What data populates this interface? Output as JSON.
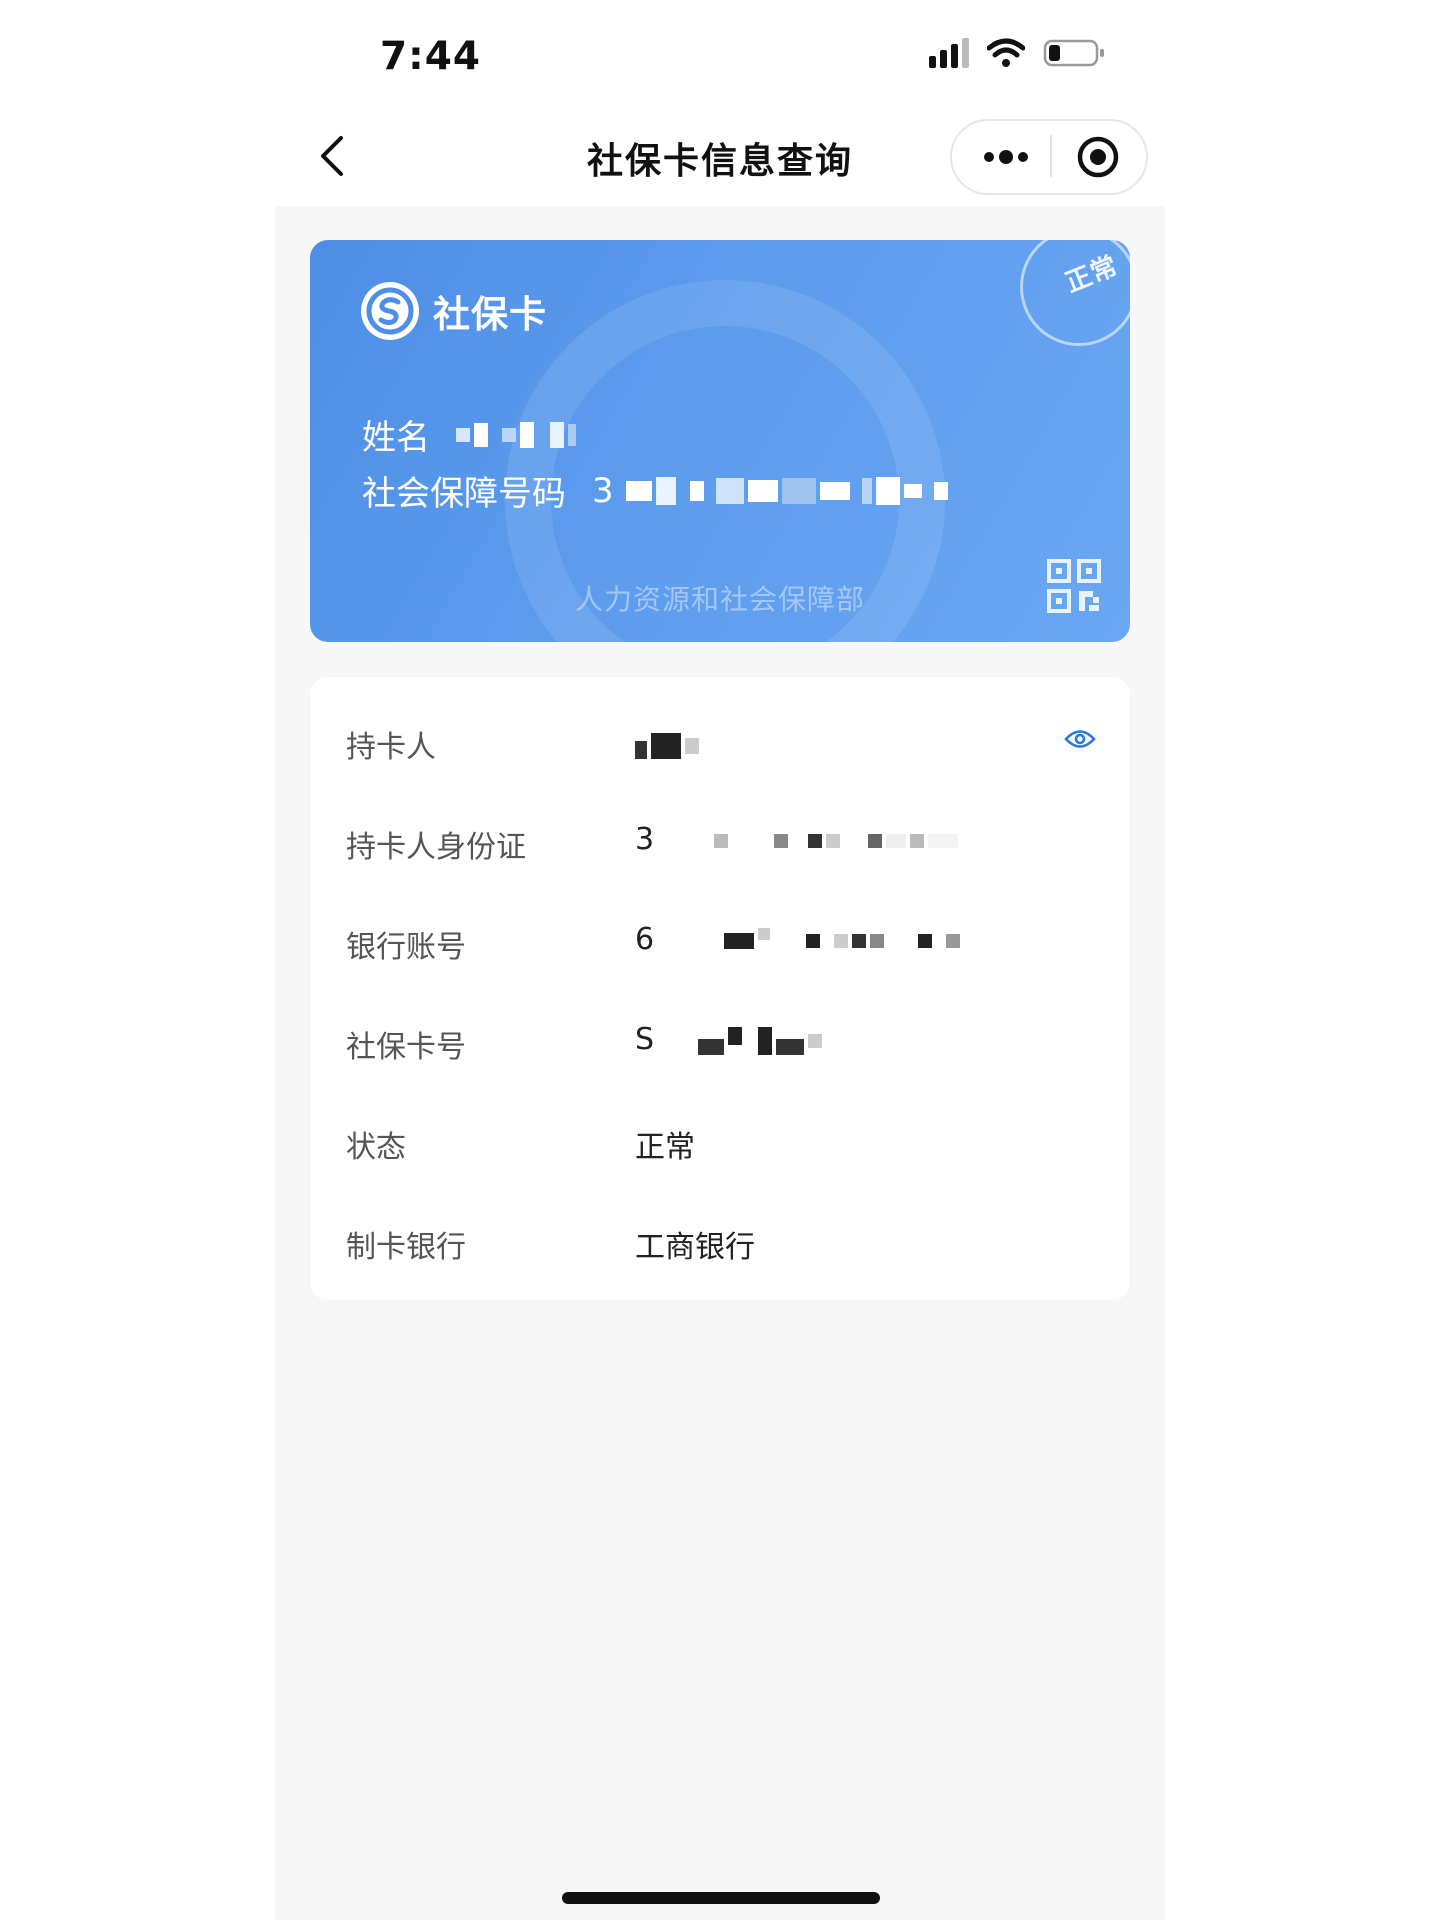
{
  "status_bar": {
    "time": "7:44"
  },
  "nav": {
    "title": "社保卡信息查询"
  },
  "card": {
    "brand": "社保卡",
    "stamp": "正常",
    "name_label": "姓名",
    "ssn_label": "社会保障号码",
    "ssn_prefix": "3",
    "ministry": "人力资源和社会保障部"
  },
  "info": {
    "rows": [
      {
        "label": "持卡人",
        "value": ""
      },
      {
        "label": "持卡人身份证",
        "value": "3"
      },
      {
        "label": "银行账号",
        "value": "6"
      },
      {
        "label": "社保卡号",
        "value": "S"
      },
      {
        "label": "状态",
        "value": "正常"
      },
      {
        "label": "制卡银行",
        "value": "工商银行"
      }
    ]
  },
  "colors": {
    "card_blue": "#5d9ced",
    "eye_blue": "#2a7ae2"
  },
  "icons": [
    "back-icon",
    "more-icon",
    "close-capsule-icon",
    "social-security-logo-icon",
    "qr-code-icon",
    "eye-icon"
  ]
}
